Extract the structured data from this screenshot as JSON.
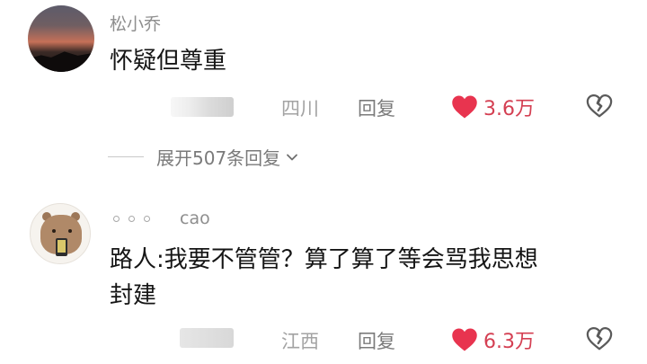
{
  "comments": [
    {
      "username": "松小乔",
      "content_lines": [
        "怀疑但尊重"
      ],
      "location": "四川",
      "reply_label": "回复",
      "like_count": "3.6万",
      "avatar": "sunset-silhouette"
    },
    {
      "username": "cao",
      "content_lines": [
        "路人:我要不管管？算了算了等会骂我思想",
        "封建"
      ],
      "location": "江西",
      "reply_label": "回复",
      "like_count": "6.3万",
      "avatar": "bear-holding-phone"
    }
  ],
  "expand_replies": {
    "label": "展开507条回复",
    "icon": "chevron-down-icon"
  },
  "icons": {
    "like": "heart-icon",
    "dislike": "broken-heart-icon"
  },
  "colors": {
    "like_red": "#e8344f",
    "like_count": "#d43f52",
    "meta_gray": "#a3a3a3",
    "username_gray": "#8e8e8e"
  }
}
